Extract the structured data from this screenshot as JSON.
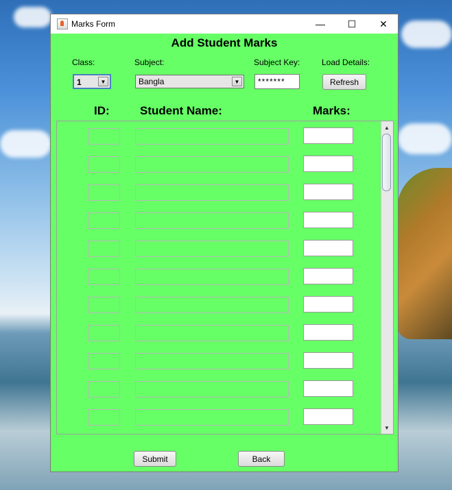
{
  "window": {
    "title": "Marks Form",
    "minimize": "—",
    "maximize": "☐",
    "close": "✕"
  },
  "form": {
    "heading": "Add Student Marks",
    "class_label": "Class:",
    "class_value": "1",
    "subject_label": "Subject:",
    "subject_value": "Bangla",
    "subject_key_label": "Subject Key:",
    "subject_key_value": "*******",
    "load_details_label": "Load Details:",
    "refresh_label": "Refresh"
  },
  "table": {
    "headers": {
      "id": "ID:",
      "name": "Student Name:",
      "marks": "Marks:"
    },
    "rows": [
      {
        "id": "",
        "name": "",
        "marks": ""
      },
      {
        "id": "",
        "name": "",
        "marks": ""
      },
      {
        "id": "",
        "name": "",
        "marks": ""
      },
      {
        "id": "",
        "name": "",
        "marks": ""
      },
      {
        "id": "",
        "name": "",
        "marks": ""
      },
      {
        "id": "",
        "name": "",
        "marks": ""
      },
      {
        "id": "",
        "name": "",
        "marks": ""
      },
      {
        "id": "",
        "name": "",
        "marks": ""
      },
      {
        "id": "",
        "name": "",
        "marks": ""
      },
      {
        "id": "",
        "name": "",
        "marks": ""
      },
      {
        "id": "",
        "name": "",
        "marks": ""
      }
    ]
  },
  "footer": {
    "submit_label": "Submit",
    "back_label": "Back"
  },
  "colors": {
    "form_background": "#66ff66"
  },
  "icons": {
    "app": "java-cup-icon",
    "scroll_up": "scroll-up-arrow-icon",
    "scroll_down": "scroll-down-arrow-icon",
    "dropdown": "chevron-down-icon"
  }
}
